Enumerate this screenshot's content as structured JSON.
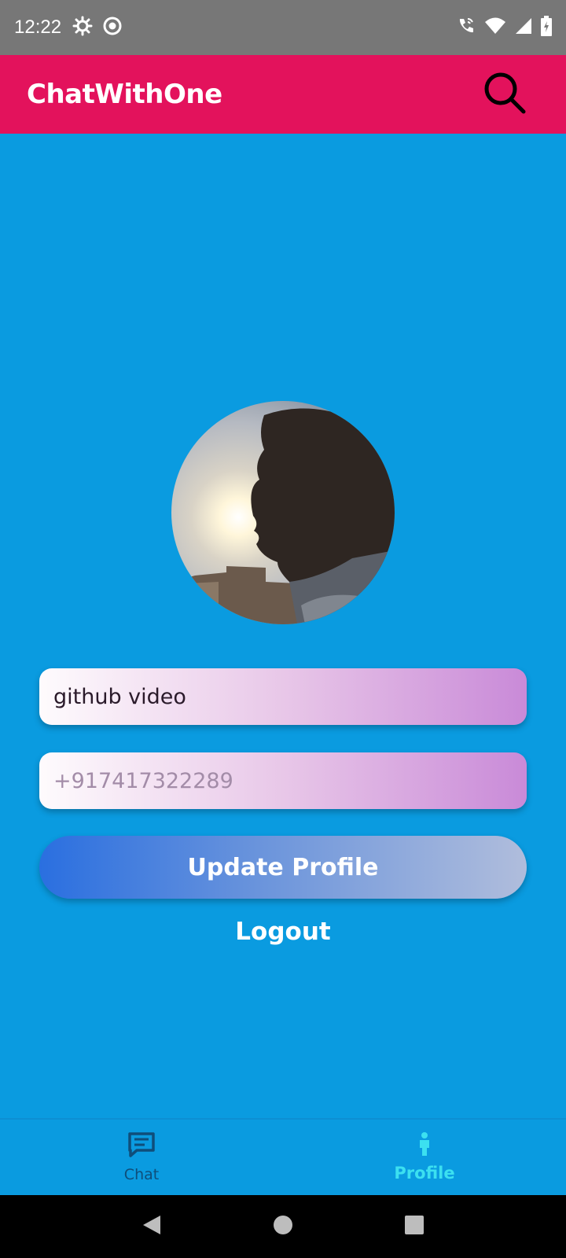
{
  "status_bar": {
    "time": "12:22",
    "left_icons": [
      "settings-icon",
      "record-icon"
    ],
    "right_icons": [
      "wifi-call-icon",
      "wifi-icon",
      "signal-icon",
      "battery-icon"
    ]
  },
  "app_bar": {
    "title": "ChatWithOne",
    "action_icon": "search-icon",
    "color": "#e3125c"
  },
  "profile": {
    "name_value": "github video",
    "phone_placeholder": "+917417322289",
    "update_label": "Update Profile",
    "logout_label": "Logout"
  },
  "bottom_nav": {
    "items": [
      {
        "label": "Chat",
        "icon": "chat-icon",
        "selected": false
      },
      {
        "label": "Profile",
        "icon": "person-icon",
        "selected": true
      }
    ]
  },
  "colors": {
    "background": "#0a9be0",
    "accent_selected": "#3ce0f0"
  }
}
